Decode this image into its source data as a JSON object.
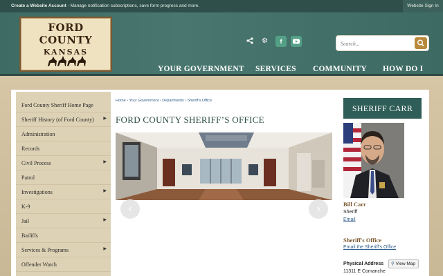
{
  "topbar": {
    "create_bold": "Create a Website Account",
    "create_rest": " - Manage notification subscriptions, save form progress and more.",
    "signin": "Website Sign In"
  },
  "logo": {
    "line1": "FORD COUNTY",
    "line2": "KANSAS"
  },
  "social": {
    "facebook": "f",
    "youtube": "▶"
  },
  "search": {
    "placeholder": "Search..."
  },
  "nav": [
    "YOUR GOVERNMENT",
    "SERVICES",
    "COMMUNITY",
    "HOW DO I"
  ],
  "sidebar": {
    "items": [
      {
        "label": "Ford County Sheriff Home Page",
        "arrow": ""
      },
      {
        "label": "Sheriff History (of Ford County)",
        "arrow": "▶"
      },
      {
        "label": "Administration",
        "arrow": ""
      },
      {
        "label": "Records",
        "arrow": ""
      },
      {
        "label": "Civil Process",
        "arrow": "▶"
      },
      {
        "label": "Patrol",
        "arrow": ""
      },
      {
        "label": "Investigations",
        "arrow": "▶"
      },
      {
        "label": "K-9",
        "arrow": ""
      },
      {
        "label": "Jail",
        "arrow": "▶"
      },
      {
        "label": "Bailiffs",
        "arrow": ""
      },
      {
        "label": "Services & Programs",
        "arrow": "▶"
      },
      {
        "label": "Offender Watch",
        "arrow": ""
      }
    ]
  },
  "breadcrumb": "Home › Your Government › Departments › Sheriff's Office",
  "page_title": "FORD COUNTY SHERIFF’S OFFICE",
  "carousel": {
    "prev": "‹",
    "next": "›"
  },
  "right": {
    "header": "SHERIFF CARR",
    "name": "Bill Carr",
    "role": "Sheriff",
    "email": "Email",
    "office_title": "Sheriff's Office",
    "office_email": "Email the Sheriff's Office",
    "address_label": "Physical Address",
    "view_map": "View Map",
    "street": "11311 E Comanche"
  },
  "colors": {
    "header_teal": "#3e6b63",
    "topbar": "#2f4f4a",
    "accent_gold": "#b78a3b",
    "link_blue": "#2e5c8a",
    "sidebar_tan": "#ddd2b5"
  }
}
